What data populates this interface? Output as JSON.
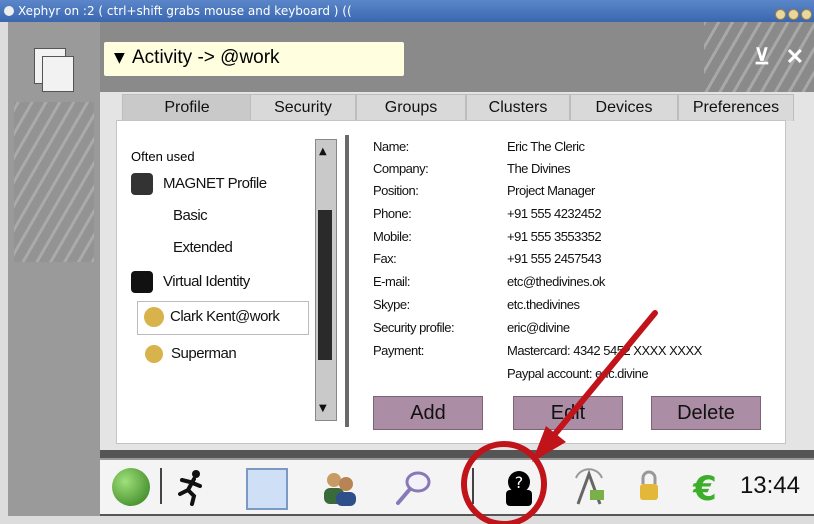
{
  "window": {
    "title": "Xephyr on :2 ( ctrl+shift grabs mouse and keyboard ) (("
  },
  "header": {
    "breadcrumb": "Activity -> @work",
    "min_icon": "minimize-icon",
    "close_icon": "close-icon"
  },
  "tabs": [
    {
      "label": "Profile",
      "active": true
    },
    {
      "label": "Security"
    },
    {
      "label": "Groups"
    },
    {
      "label": "Clusters"
    },
    {
      "label": "Devices"
    },
    {
      "label": "Preferences"
    }
  ],
  "profile_list": {
    "heading": "Often used",
    "items": [
      "MAGNET Profile",
      "Basic",
      "Extended",
      "Virtual Identity",
      "Clark Kent@work",
      "Superman"
    ],
    "selected": "Clark Kent@work"
  },
  "details": {
    "labels": [
      "Name:",
      "Company:",
      "Position:",
      "Phone:",
      "Mobile:",
      "Fax:",
      "E-mail:",
      "Skype:",
      "Security profile:",
      "Payment:"
    ],
    "values": [
      "Eric The Cleric",
      "The Divines",
      "Project Manager",
      "+91 555 4232452",
      "+91 555 3553352",
      "+91 555 2457543",
      "etc@thedivines.ok",
      "etc.thedivines",
      "eric@divine",
      "Mastercard: 4342 5452 XXXX XXXX",
      "Paypal account: eric.divine"
    ]
  },
  "buttons": {
    "add": "Add",
    "edit": "Edit",
    "delete": "Delete"
  },
  "taskbar": {
    "icons": [
      "globe-icon",
      "runner-icon",
      "contacts-icon",
      "users-icon",
      "search-icon",
      "identity-icon",
      "wireless-icon",
      "keys-icon",
      "euro-icon"
    ],
    "clock": "13:44"
  },
  "colors": {
    "accent_button": "#ab8da6",
    "annotation": "#c0131a"
  }
}
